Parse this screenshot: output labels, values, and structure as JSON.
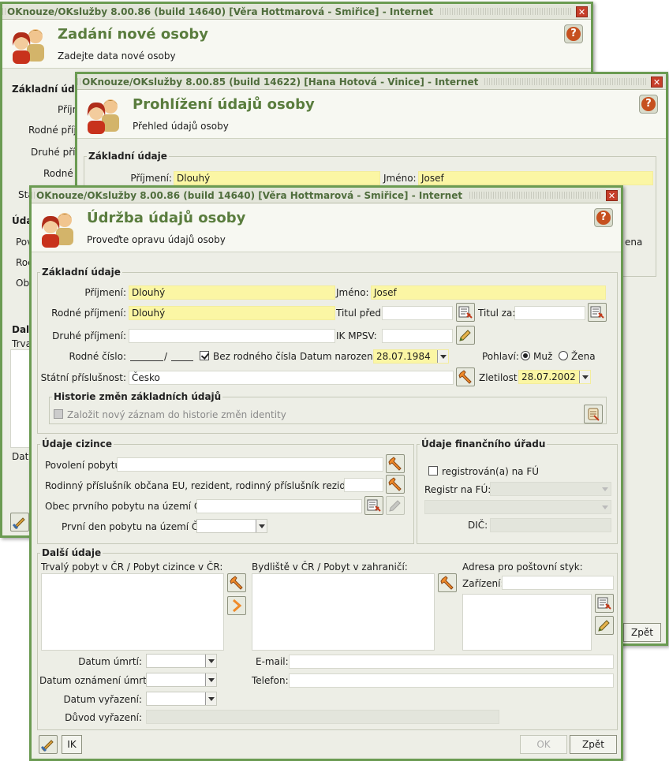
{
  "win1": {
    "title": "OKnouze/OKslužby 8.00.86 (build 14640)  [Věra Hottmarová - Smiřice] - Internet",
    "header_title": "Zadání nové osoby",
    "header_subtitle": "Zadejte data nové osoby",
    "group_basic": "Základní údaje",
    "labels": [
      "Příjm",
      "Rodné příjm",
      "Druhé příjm",
      "Rodné č",
      "Stá"
    ],
    "group2": "Úda",
    "labels2": [
      "Pov",
      "Roc",
      "Obe"
    ],
    "group3": "Dalš",
    "trvaly": "Trval",
    "datum": "Datu"
  },
  "win2": {
    "title": "OKnouze/OKslužby 8.00.85 (build 14622)  [Hana Hotová - Vinice] - Internet",
    "header_title": "Prohlížení údajů osoby",
    "header_subtitle": "Přehled údajů osoby",
    "group_basic": "Základní údaje",
    "prijmeni_label": "Příjmení:",
    "prijmeni_value": "Dlouhý",
    "jmeno_label": "Jméno:",
    "jmeno_value": "Josef",
    "partial_label": "ena",
    "back_button": "Zpět"
  },
  "win3": {
    "title": "OKnouze/OKslužby 8.00.86 (build 14640)  [Věra Hottmarová - Smiřice] - Internet",
    "header_title": "Údržba údajů osoby",
    "header_subtitle": "Proveďte opravu údajů osoby",
    "basic": {
      "legend": "Základní údaje",
      "prijmeni_label": "Příjmení:",
      "prijmeni_value": "Dlouhý",
      "jmeno_label": "Jméno:",
      "jmeno_value": "Josef",
      "rodne_prijmeni_label": "Rodné příjmení:",
      "rodne_prijmeni_value": "Dlouhý",
      "titul_pred_label": "Titul před:",
      "titul_za_label": "Titul za:",
      "druhe_prijmeni_label": "Druhé příjmení:",
      "ik_mpsv_label": "IK MPSV:",
      "rodne_cislo_label": "Rodné číslo:",
      "rodne_cislo_sep": "/",
      "bez_rc_label": "Bez rodného čísla",
      "datum_narozeni_label": "Datum narození:",
      "datum_narozeni_value": "28.07.1984",
      "pohlavi_label": "Pohlaví:",
      "muz_label": "Muž",
      "zena_label": "Žena",
      "statni_prislusnost_label": "Státní příslušnost:",
      "statni_prislusnost_value": "Česko",
      "zletilost_label": "Zletilost:",
      "zletilost_value": "28.07.2002",
      "history_legend": "Historie změn základních údajů",
      "history_checkbox_label": "Založit nový záznam do historie změn identity"
    },
    "cizinec": {
      "legend": "Údaje cizince",
      "povoleni_label": "Povolení pobytu:",
      "rodinny_label": "Rodinný příslušník občana EU, rezident, rodinný příslušník rezidenta:",
      "obec_label": "Obec prvního pobytu na území ČR:",
      "prvni_den_label": "První den pobytu na území ČR:"
    },
    "fu": {
      "legend": "Údaje finančního úřadu",
      "registrovan_label": "registrován(a) na FÚ",
      "registr_label": "Registr na FÚ:",
      "dic_label": "DIČ:"
    },
    "dalsi": {
      "legend": "Další údaje",
      "trvaly_label": "Trvalý pobyt v ČR / Pobyt cizince v ČR:",
      "bydliste_label": "Bydliště v ČR / Pobyt v zahraničí:",
      "adresa_label": "Adresa pro poštovní styk:",
      "zarizeni_label": "Zařízení:",
      "datum_umrti_label": "Datum úmrtí:",
      "email_label": "E-mail:",
      "datum_oznameni_label": "Datum oznámení úmrtí:",
      "telefon_label": "Telefon:",
      "datum_vyrazeni_label": "Datum vyřazení:",
      "duvod_label": "Důvod vyřazení:"
    },
    "footer": {
      "ik_button": "IK",
      "ok_button": "OK",
      "back_button": "Zpět"
    }
  }
}
